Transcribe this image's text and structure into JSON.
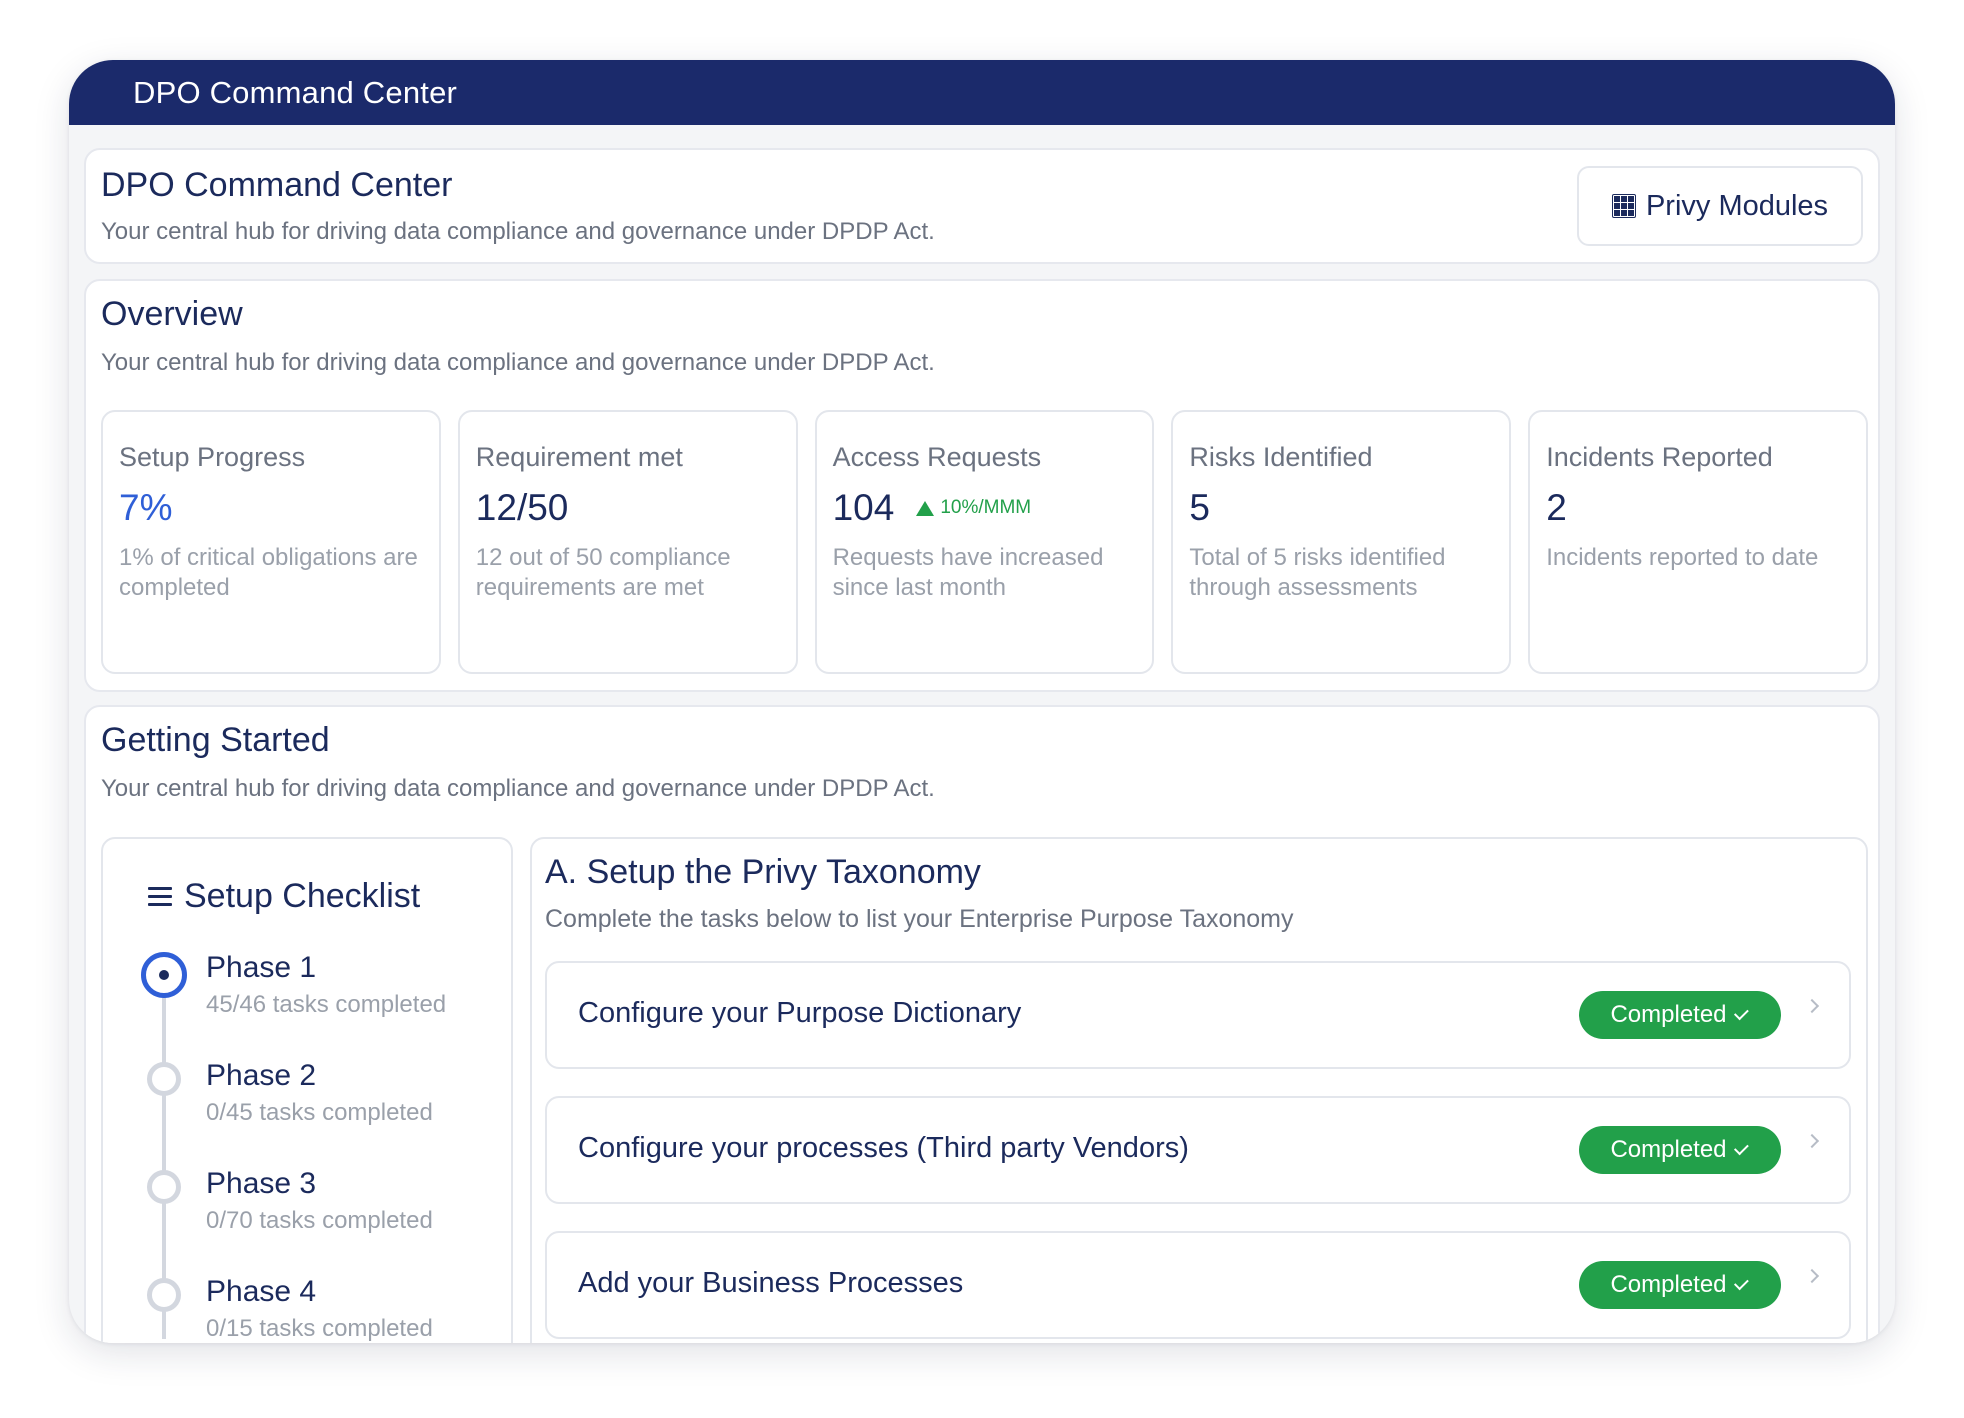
{
  "window": {
    "title": "DPO Command Center"
  },
  "header": {
    "title": "DPO Command Center",
    "subtitle": "Your central hub for driving data compliance and governance under DPDP Act.",
    "modules_button": "Privy Modules",
    "modules_icon": "grid-icon"
  },
  "overview": {
    "title": "Overview",
    "subtitle": "Your central hub for driving data compliance and governance under DPDP Act.",
    "stats": [
      {
        "label": "Setup Progress",
        "value": "7%",
        "desc": "1% of critical obligations are completed"
      },
      {
        "label": "Requirement met",
        "value": "12/50",
        "desc": "12 out of 50 compliance requirements are met"
      },
      {
        "label": "Access Requests",
        "value": "104",
        "trend": "10%/MMM",
        "trend_icon": "trend-up-icon",
        "desc": "Requests have increased since last month"
      },
      {
        "label": "Risks Identified",
        "value": "5",
        "desc": "Total of 5 risks identified through assessments"
      },
      {
        "label": "Incidents Reported",
        "value": "2",
        "desc": "Incidents reported to date"
      }
    ]
  },
  "getting_started": {
    "title": "Getting Started",
    "subtitle": "Your central hub for driving data compliance and governance under DPDP Act.",
    "checklist": {
      "title": "Setup Checklist",
      "icon": "menu-icon",
      "phases": [
        {
          "name": "Phase 1",
          "tasks": "45/46 tasks completed",
          "active": true
        },
        {
          "name": "Phase 2",
          "tasks": "0/45 tasks completed",
          "active": false
        },
        {
          "name": "Phase 3",
          "tasks": "0/70 tasks completed",
          "active": false
        },
        {
          "name": "Phase 4",
          "tasks": "0/15 tasks completed",
          "active": false
        }
      ]
    },
    "taxonomy": {
      "title": "A. Setup the Privy Taxonomy",
      "subtitle": "Complete the tasks below to list your Enterprise Purpose Taxonomy",
      "tasks": [
        {
          "name": "Configure your Purpose Dictionary",
          "status": "Completed"
        },
        {
          "name": "Configure your processes (Third party Vendors)",
          "status": "Completed"
        },
        {
          "name": "Add your Business Processes",
          "status": "Completed"
        }
      ]
    }
  },
  "colors": {
    "titlebar": "#1b2a6b",
    "text_primary": "#1b2a5c",
    "accent_blue": "#2f5fd7",
    "success_green": "#22a04a"
  }
}
